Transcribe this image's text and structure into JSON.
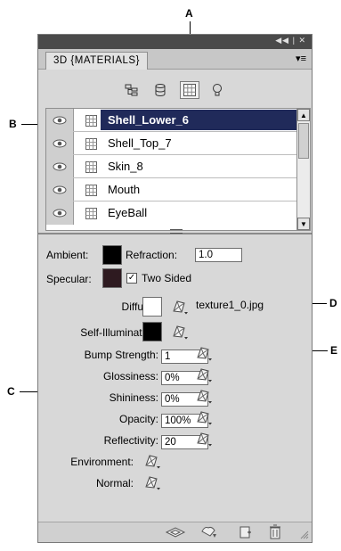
{
  "callouts": {
    "a": "A",
    "b": "B",
    "c": "C",
    "d": "D",
    "e": "E"
  },
  "panel": {
    "window_controls": "◀◀ | ✕",
    "tab_title": "3D {MATERIALS}",
    "menu_icon": "panel-menu-icon",
    "filter_buttons": [
      "whole-scene-icon",
      "meshes-icon",
      "materials-icon",
      "lights-icon"
    ],
    "selected_filter": "materials"
  },
  "materials": [
    {
      "name": "Shell_Lower_6",
      "selected": true
    },
    {
      "name": "Shell_Top_7",
      "selected": false
    },
    {
      "name": "Skin_8",
      "selected": false
    },
    {
      "name": "Mouth",
      "selected": false
    },
    {
      "name": "EyeBall",
      "selected": false
    }
  ],
  "properties": {
    "ambient_label": "Ambient:",
    "refraction_label": "Refraction:",
    "refraction_value": "1.0",
    "specular_label": "Specular:",
    "two_sided_label": "Two Sided",
    "two_sided_checked": true,
    "diffuse_label": "Diffuse:",
    "diffuse_texture": "texture1_0.jpg",
    "self_illumination_label": "Self-Illumination:",
    "bump_label": "Bump Strength:",
    "bump_value": "1",
    "glossiness_label": "Glossiness:",
    "glossiness_value": "0%",
    "shininess_label": "Shininess:",
    "shininess_value": "0%",
    "opacity_label": "Opacity:",
    "opacity_value": "100%",
    "reflectivity_label": "Reflectivity:",
    "reflectivity_value": "20",
    "environment_label": "Environment:",
    "normal_label": "Normal:"
  },
  "colors": {
    "ambient": "#000000",
    "specular": "#2e1a20",
    "diffuse": "#ffffff",
    "self_illumination": "#000000",
    "selection": "#202a5a"
  },
  "bottom_icons": [
    "select-material-icon",
    "drop-material-icon",
    "new-light-icon",
    "delete-icon"
  ]
}
